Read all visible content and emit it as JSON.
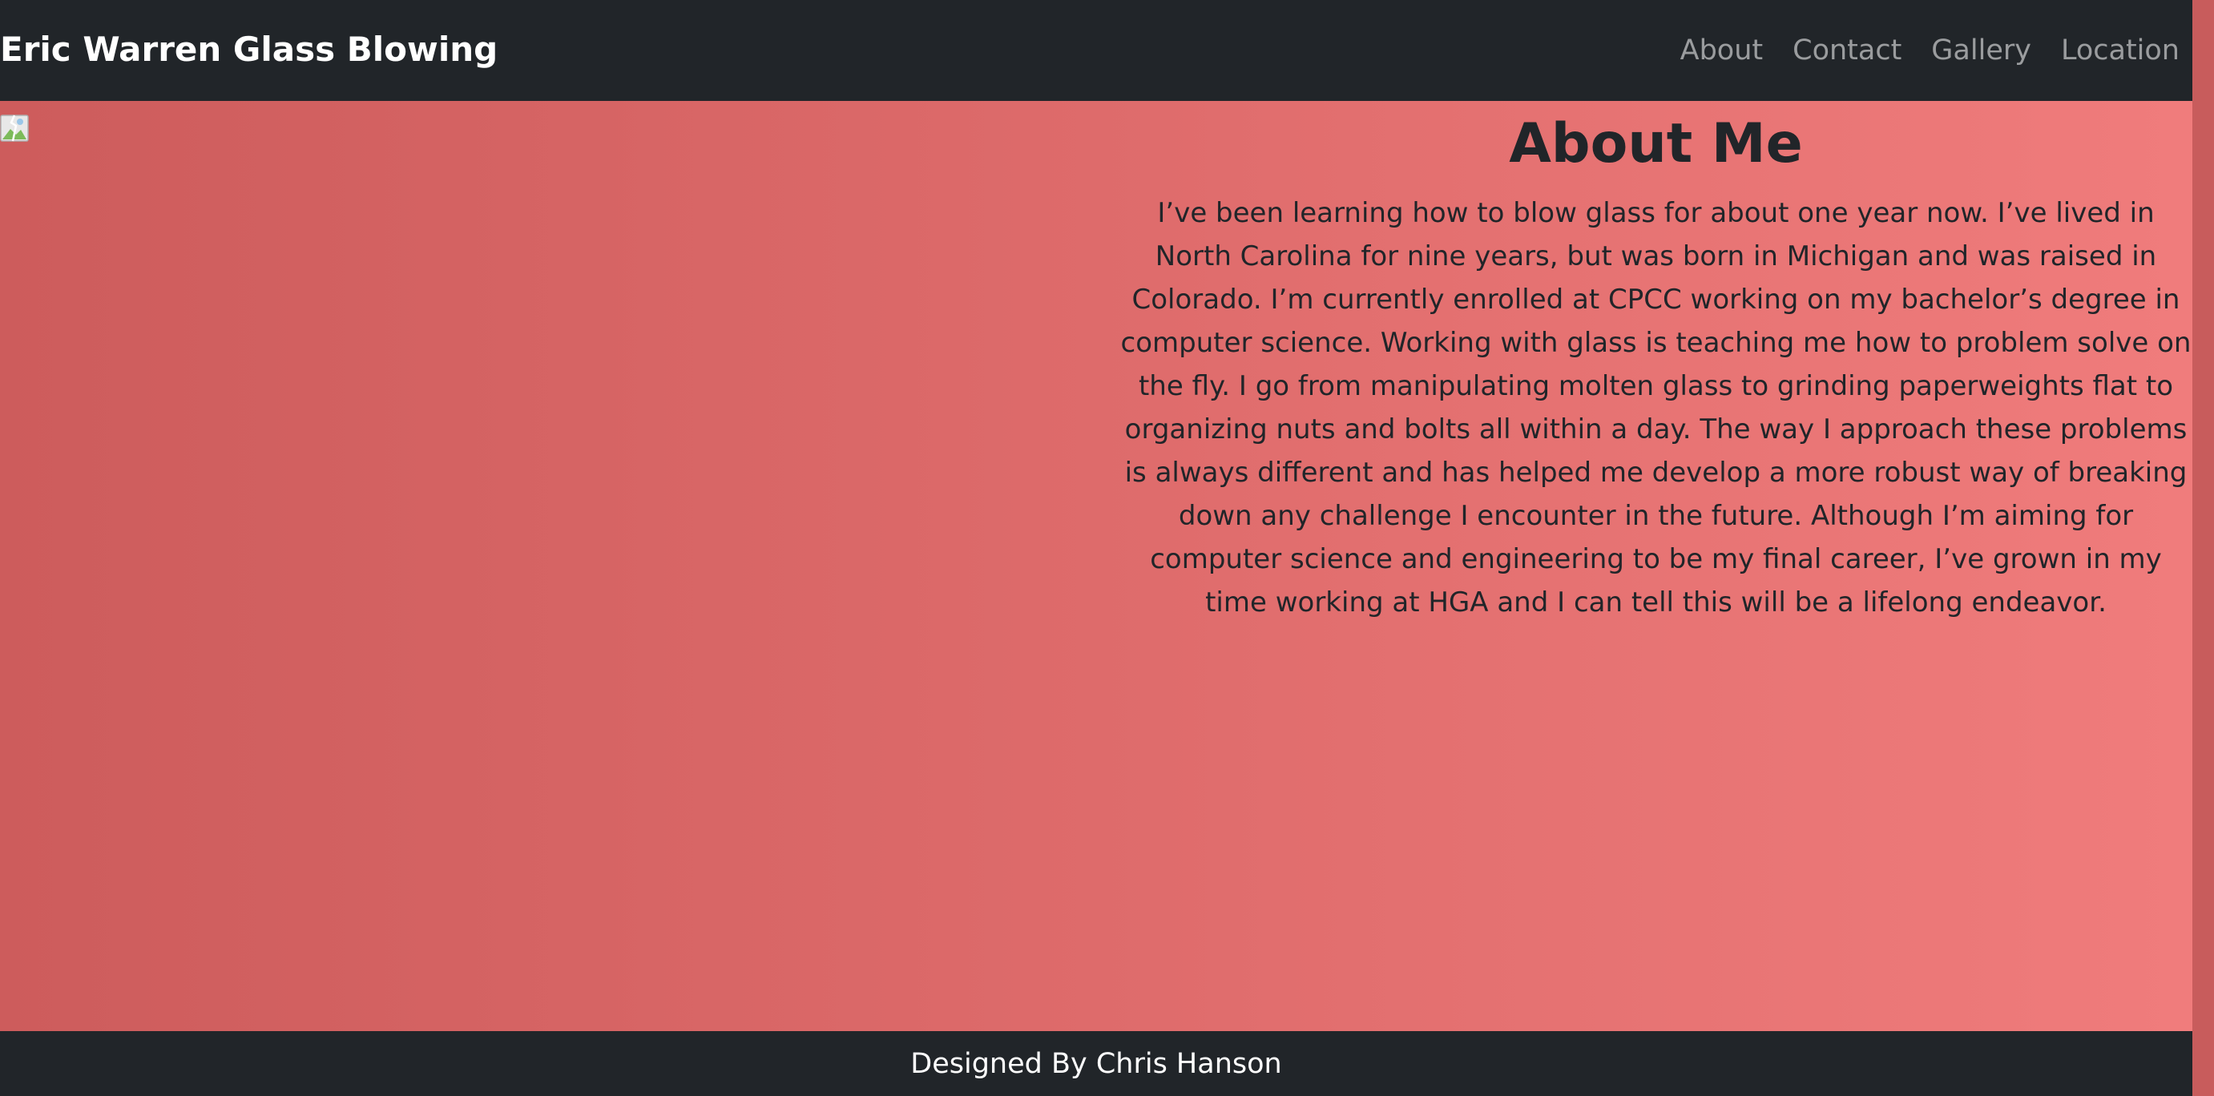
{
  "navbar": {
    "brand": "Eric Warren Glass Blowing",
    "links": [
      "About",
      "Contact",
      "Gallery",
      "Location"
    ]
  },
  "main": {
    "image_alt": "",
    "heading": "About Me",
    "paragraph": "I’ve been learning how to blow glass for about one year now. I’ve lived in North Carolina for nine years, but was born in Michigan and was raised in Colorado. I’m currently enrolled at CPCC working on my bachelor’s degree in computer science. Working with glass is teaching me how to problem solve on the fly. I go from manipulating molten glass to grinding paperweights flat to organizing nuts and bolts all within a day. The way I approach these problems is always different and has helped me develop a more robust way of breaking down any challenge I encounter in the future. Although I’m aiming for computer science and engineering to be my final career, I’ve grown in my time working at HGA and I can tell this will be a lifelong endeavor."
  },
  "footer": {
    "credit": "Designed By Chris Hanson"
  },
  "colors": {
    "navbar_bg": "#212529",
    "gradient_start": "#cd5c5c",
    "gradient_end": "#f07c7c",
    "text_dark": "#212529"
  }
}
